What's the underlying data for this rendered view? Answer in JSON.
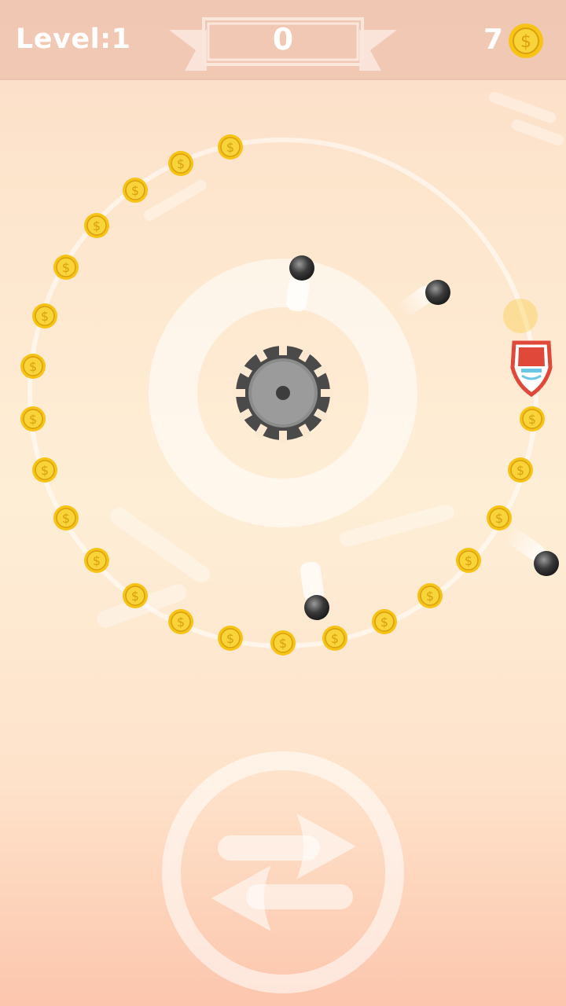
{
  "hud": {
    "level_label": "Level:1",
    "score": "0",
    "coins": "7",
    "coin_icon": "dollar-coin-icon"
  },
  "controls": {
    "swap_icon": "swap-direction-arrows-icon"
  },
  "colors": {
    "coin_gold": "#f7c316",
    "coin_shadow": "#d9a10a",
    "gear_gray": "#8c8c8c",
    "gear_dark": "#4a4a4a",
    "player_red": "#e0483a",
    "ball_dark": "#3a3a3a"
  }
}
